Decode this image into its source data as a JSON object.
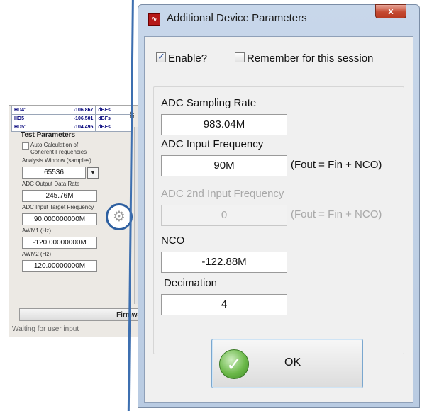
{
  "background_app": {
    "hd_rows": [
      {
        "name": "HD4'",
        "value": "-106.867",
        "unit": "dBFs"
      },
      {
        "name": "HD5",
        "value": "-106.501",
        "unit": "dBFs"
      },
      {
        "name": "HD5'",
        "value": "-104.495",
        "unit": "dBFs"
      }
    ],
    "side_label": "dB",
    "test_params_title": "Test Parameters",
    "auto_calc_label_1": "Auto Calculation of",
    "auto_calc_label_2": "Coherent Frequencies",
    "analysis_window_label": "Analysis Window (samples)",
    "analysis_window_value": "65536",
    "adc_output_rate_label": "ADC Output Data Rate",
    "adc_output_rate_value": "245.76M",
    "adc_input_target_label": "ADC Input Target Frequency",
    "adc_input_target_value": "90.000000000M",
    "awm1_label": "AWM1 (Hz)",
    "awm1_value": "-120.00000000M",
    "awm2_label": "AWM2 (Hz)",
    "awm2_value": "120.00000000M",
    "firmware_label": "Firmware V",
    "status": "Waiting for user input"
  },
  "dialog": {
    "title": "Additional Device Parameters",
    "close_glyph": "x",
    "enable_label": "Enable?",
    "enable_checked": true,
    "remember_label": "Remember for this session",
    "remember_checked": false,
    "fields": {
      "adc_sampling_rate": {
        "label": "ADC Sampling Rate",
        "value": "983.04M"
      },
      "adc_input_frequency": {
        "label": "ADC Input  Frequency",
        "value": "90M",
        "note": "(Fout = Fin + NCO)"
      },
      "adc_2nd_input_frequency": {
        "label": "ADC 2nd Input  Frequency",
        "value": "0",
        "note": "(Fout = Fin + NCO)",
        "disabled": true
      },
      "nco": {
        "label": "NCO",
        "value": "-122.88M"
      },
      "decimation": {
        "label": "Decimation",
        "value": "4"
      }
    },
    "ok_label": "OK"
  }
}
